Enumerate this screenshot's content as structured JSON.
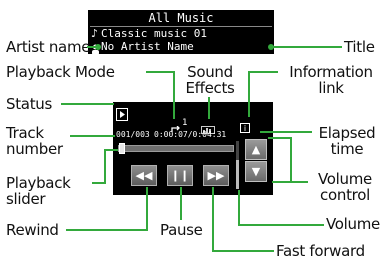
{
  "screen": {
    "title": "All Music",
    "track_title": "Classic music 01",
    "artist": "No Artist Name",
    "mode_label": "1",
    "track_counter": "001/003",
    "elapsed_time": "0:00:07/0:04:31",
    "playback_progress": 0.03,
    "volume_level": 0.6
  },
  "callouts": {
    "title": "Title",
    "artist_name": "Artist name",
    "playback_mode": "Playback Mode",
    "sound_effects_1": "Sound",
    "sound_effects_2": "Effects",
    "information_link_1": "Information",
    "information_link_2": "link",
    "status": "Status",
    "track_number_1": "Track",
    "track_number_2": "number",
    "elapsed_time_1": "Elapsed",
    "elapsed_time_2": "time",
    "playback_slider_1": "Playback",
    "playback_slider_2": "slider",
    "volume_control_1": "Volume",
    "volume_control_2": "control",
    "rewind": "Rewind",
    "pause": "Pause",
    "volume": "Volume",
    "fast_forward": "Fast forward"
  },
  "icons": {
    "note": "music-note-icon",
    "person": "person-icon",
    "status": "play-status-icon",
    "mode": "repeat-mode-icon",
    "sound": "sound-effects-icon",
    "info": "information-icon",
    "rewind": "rewind-icon",
    "pause": "pause-icon",
    "fast_forward": "fast-forward-icon",
    "up": "volume-up-icon",
    "down": "volume-down-icon"
  },
  "colors": {
    "leader_line": "#33a93c",
    "screen_background": "#000000",
    "screen_text": "#ffffff"
  }
}
